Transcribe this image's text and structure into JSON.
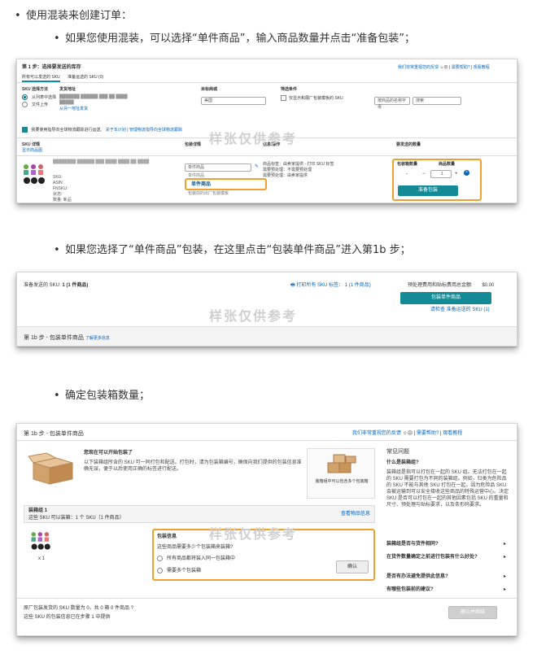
{
  "bullets": {
    "b1": "使用混装来创建订单：",
    "b2": "如果您使用混装，可以选择“单件商品”，输入商品数量并点击“准备包装”；",
    "b3": "如果您选择了“单件商品”包装，在这里点击“包装单件商品”进入第1b 步；",
    "b4": "确定包装箱数量；"
  },
  "watermark": "样张仅供参考",
  "shot1": {
    "step_title": "第 1 步：选择要发送的库存",
    "feedback": "我们非常重视您的反馈",
    "help": "需要帮助?",
    "tutorial": "观看教程",
    "tab_all": "所有可以发送的 SKU",
    "tab_ready": "准备运送的 SKU (0)",
    "sku_method_label": "SKU 选择方法",
    "sku_method_opt1": "从列表中选择",
    "sku_method_opt2": "文件上传",
    "ship_from_label": "发货地址",
    "ship_from_value": "███████ ██████ ███ ██ ████ █████",
    "ship_from_link": "从另一地址发货",
    "market_label": "目标商城",
    "market_value": "美国",
    "filter_label": "筛选条件",
    "filter_checkbox": "仅显示和展厂包装模板的 SKU",
    "sort_value": "按商品的名称字母",
    "search_placeholder": "搜索",
    "notice": "我要使用指导向全球物流跟踪进行运送。",
    "notice_link1": "关于本计划",
    "notice_link2": "管理物流指导向全球物流跟踪",
    "col_sku": "SKU 详情",
    "col_sku_sub": "显示商品图",
    "col_pack": "包装详情",
    "col_info": "信息/操作",
    "col_qty": "要发送的数量",
    "sku_fields": [
      "SKU:",
      "ASIN:",
      "FNSKU:",
      "状态:",
      "数量:"
    ],
    "sku_status": "新品",
    "pack_select": "单件商品",
    "dropdown_opt1": "单件商品",
    "dropdown_opt2": "包装前的出厂包装模板",
    "info_lines": [
      "商品标签：由卖家提供 - 打印 SKU 标签",
      "需要预处理：不需要预处理",
      "需要预处理：由卖家提供"
    ],
    "box_qty_label": "包装箱数量",
    "units_label": "商品数量",
    "box_qty_value": "-",
    "units_value": "1",
    "prepare_button": "准备包装"
  },
  "shot2": {
    "ready_text": "准备发送的 SKU:",
    "ready_count": "1 (1 件商品)",
    "print_link": "打印所有 SKU 标签：",
    "print_count": "1 (1 件商品)",
    "fee_label": "预处理费用和贴标费用总金额:",
    "fee_value": "$0.00",
    "pack_button": "包装单件商品",
    "view_link": "请检查 准备运送的 SKU (1)",
    "step_title": "第 1b 步 - 包装单件商品",
    "more_link": "了解更多信息"
  },
  "shot3": {
    "step_title": "第 1b 步 - 包装单件商品",
    "feedback": "我们非常重视您的反馈",
    "help": "需要帮助?",
    "tutorial": "观看教程",
    "intro_title": "您现在可以开始包装了",
    "intro_text": "以下装箱组所含的 SKU 可一同打包和配送。打包时，请为包装箱编号，确保向我们提供的包装信息准确无误，便于以后使用正确的标签进行配送。",
    "group_image_caption": "装箱组中可以包含多个包装箱",
    "faq_title": "常见问题",
    "faq_q1": "什么是装箱组?",
    "faq_a1": "装箱组是指可以打包在一起的 SKU 组。无法打包在一起的 SKU 需要打包为不同的装箱组。例如，归类为危险品的 SKU 不能与其他 SKU 打包在一起，因为危险品 SKU 会被运输到可以安全接收这些商品的特殊运营中心。决定 SKU 是否可以打包在一起的其他因素包括 SKU 的重量和尺寸、预处理与贴标要求，以及条形码要求。",
    "faq_q2": "装箱组是否与货件相同?",
    "faq_q3": "在货件数量确定之前进行包装有什么好处?",
    "faq_q4": "是否有办法避免提供此信息?",
    "faq_q5": "有哪些包装前的建议?",
    "group_title": "装箱组 1",
    "group_sub": "这些 SKU 可以装箱：1 个 SKU（1 件商品）",
    "view_items": "查看物品信息",
    "item_qty": "x 1",
    "pack_info_title": "包装信息",
    "pack_question": "这些商品需要多少个包装箱来装箱?",
    "pack_opt1": "所有商品都将装入同一包装箱中",
    "pack_opt2": "需要多个包装箱",
    "confirm_button": "确认",
    "footer_line1": "原厂包装发货的 SKU 数量为 0，共 0 箱 0 件商品",
    "footer_line2": "这些 SKU 的包装信息已在步骤 1 中提供",
    "continue_button": "确认并继续"
  },
  "colors": {
    "accent": "#f0a030",
    "teal": "#138b96",
    "link": "#0066c0"
  }
}
